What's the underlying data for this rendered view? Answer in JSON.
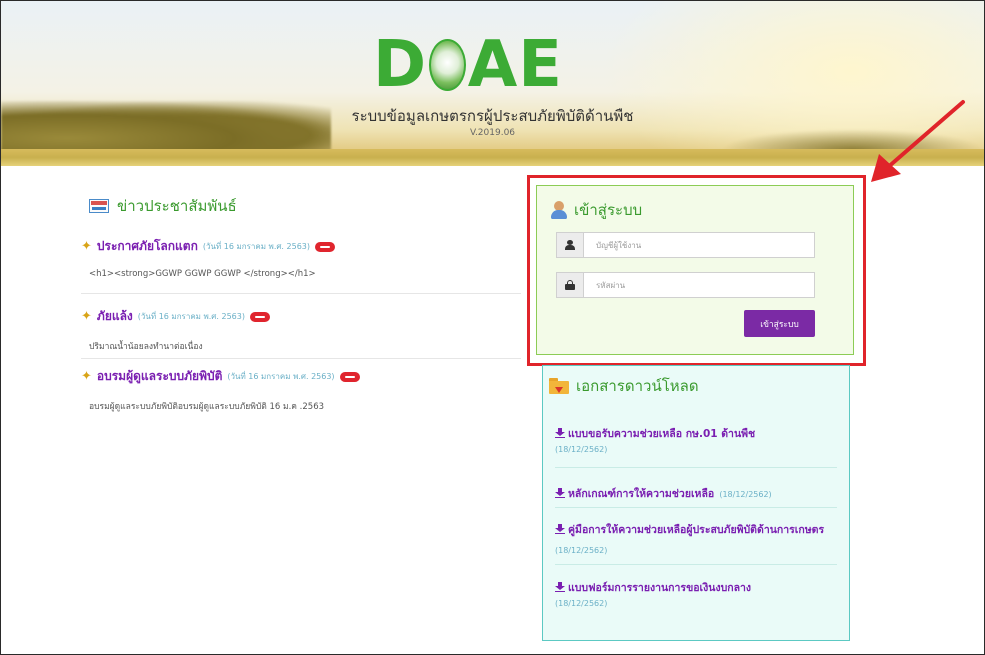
{
  "header": {
    "logo_text_left": "D",
    "logo_text_right": "AE",
    "site_title": "ระบบข้อมูลเกษตรกรผู้ประสบภัยพิบัติด้านพืช",
    "version": "V.2019.06"
  },
  "news": {
    "title": "ข่าวประชาสัมพันธ์",
    "icon": "newspaper-icon",
    "items": [
      {
        "title": "ประกาศภัยโลกแตก",
        "date": "(วันที่ 16 มกราคม พ.ศ. 2563)",
        "description": "<h1><strong>GGWP GGWP GGWP </strong></h1>"
      },
      {
        "title": "ภัยแล้ง",
        "date": "(วันที่ 16 มกราคม พ.ศ. 2563)",
        "description": "ปริมาณน้ำน้อยลงทำนาต่อเนื่อง"
      },
      {
        "title": "อบรมผู้ดูแลระบบภัยพิบัติ",
        "date": "(วันที่ 16 มกราคม พ.ศ. 2563)",
        "description": "อบรมผู้ดูแลระบบภัยพิบัติอบรมผู้ดูแลระบบภัยพิบัติ 16 ม.ค .2563"
      }
    ]
  },
  "login": {
    "title": "เข้าสู่ระบบ",
    "username_placeholder": "บัญชีผู้ใช้งาน",
    "password_placeholder": "รหัสผ่าน",
    "submit_label": "เข้าสู่ระบบ",
    "highlight_color": "#e0242a"
  },
  "downloads": {
    "title": "เอกสารดาวน์โหลด",
    "items": [
      {
        "title": "แบบขอรับความช่วยเหลือ กษ.01 ด้านพืช",
        "date": "(18/12/2562)"
      },
      {
        "title": "หลักเกณฑ์การให้ความช่วยเหลือ",
        "date": "(18/12/2562)"
      },
      {
        "title": "คู่มือการให้ความช่วยเหลือผู้ประสบภัยพิบัติด้านการเกษตร",
        "date": "(18/12/2562)"
      },
      {
        "title": "แบบฟอร์มการรายงานการขอเงินงบกลาง",
        "date": "(18/12/2562)"
      }
    ]
  },
  "colors": {
    "accent_green": "#3a9a2e",
    "link_purple": "#7a1fb1",
    "date_blue": "#6bb0c7",
    "button_purple": "#7b2aa5",
    "annotation_red": "#e0242a"
  }
}
